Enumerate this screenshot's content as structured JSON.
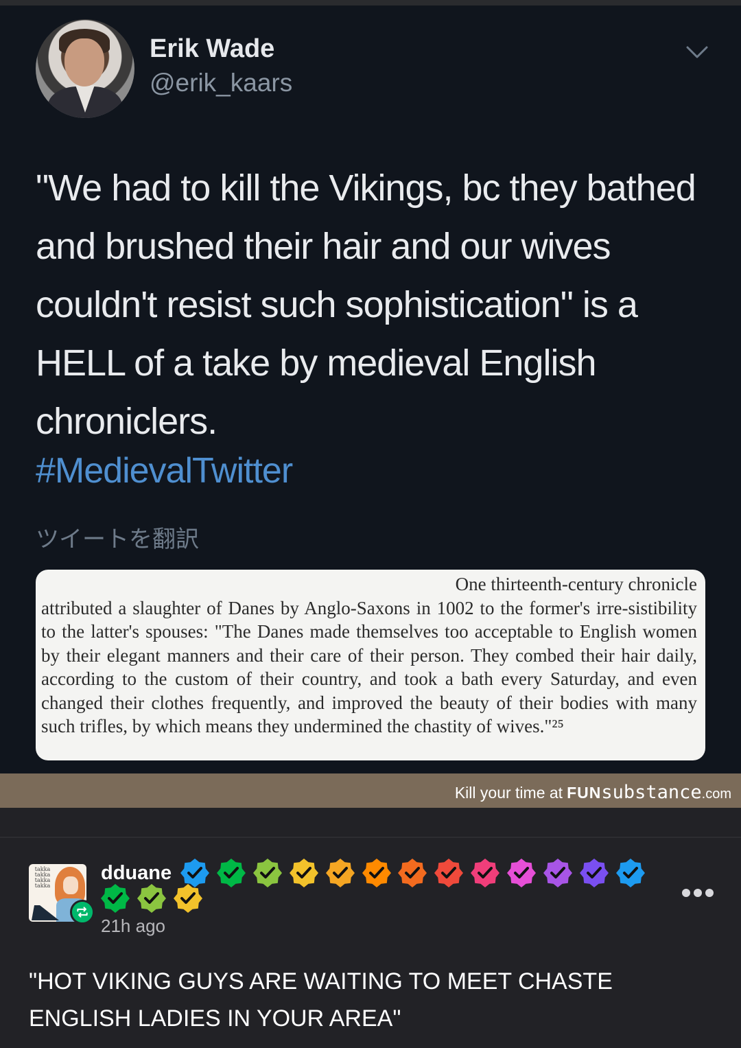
{
  "tweet": {
    "author_name": "Erik Wade",
    "author_handle": "@erik_kaars",
    "text": "\"We had to kill the Vikings, bc they bathed and brushed their hair and our wives couldn't resist such sophistication\" is a HELL of a take by medieval English chroniclers.",
    "hashtag": "#MedievalTwitter",
    "translate_label": "ツイートを翻訳",
    "chevron_icon": "chevron-down-icon",
    "excerpt_first_line": "One thirteenth-century chronicle",
    "excerpt_body": "attributed a slaughter of Danes by Anglo-Saxons in 1002 to the former's irre-sistibility to the latter's spouses: \"The Danes made themselves too acceptable to English women by their elegant manners and their care of their person. They combed their hair daily, according to the custom of their country, and took a bath every Saturday, and even changed their clothes frequently, and improved the beauty of their bodies with many such trifles, by which means they undermined the chastity of wives.\"²⁵"
  },
  "watermark": {
    "prefix": "Kill your time at",
    "brand_bold": "FUN",
    "brand_light": "substance",
    "brand_tld": ".com"
  },
  "post": {
    "username": "dduane",
    "time": "21h ago",
    "body": "\"HOT VIKING GUYS ARE WAITING TO MEET CHASTE ENGLISH LADIES IN YOUR AREA\"",
    "avatar_caption": "takka takka takka takka",
    "reblog_icon": "reblog-icon",
    "more_icon": "more-dots-icon",
    "badge_icon": "verified-check-icon",
    "badge_colors": [
      "#1d9bf0",
      "#00b846",
      "#8bc540",
      "#f2c22b",
      "#f5a623",
      "#ff8a00",
      "#f36b1f",
      "#f04a3b",
      "#f03e7a",
      "#e64fd6",
      "#a855e6",
      "#7a4ff0",
      "#1d9bf0",
      "#00b846",
      "#8bc540",
      "#f2c22b"
    ]
  }
}
